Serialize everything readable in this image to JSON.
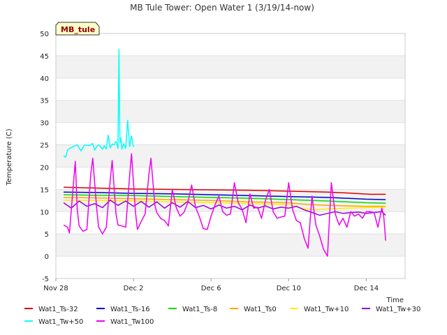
{
  "chart_data": {
    "type": "line",
    "title": "MB Tule Tower: Open Water 1 (3/19/14-now)",
    "site_badge": "MB_tule",
    "xlabel": "Time",
    "ylabel": "Temperature (C)",
    "ylim": [
      -5,
      50
    ],
    "xlim": [
      0,
      18
    ],
    "yticks": [
      -5,
      0,
      5,
      10,
      15,
      20,
      25,
      30,
      35,
      40,
      45,
      50
    ],
    "xticks": [
      {
        "value": 0,
        "label": "Nov 28"
      },
      {
        "value": 4,
        "label": "Dec 2"
      },
      {
        "value": 8,
        "label": "Dec 6"
      },
      {
        "value": 12,
        "label": "Dec 10"
      },
      {
        "value": 16,
        "label": "Dec 14"
      }
    ],
    "grid": true,
    "legend_position": "bottom",
    "series": [
      {
        "name": "Wat1_Ts-32",
        "color": "#dd0000",
        "x": [
          0.4,
          2,
          4,
          6,
          8,
          10,
          12,
          14,
          15,
          15.8,
          16.2,
          17
        ],
        "y": [
          15.5,
          15.3,
          15.1,
          15.0,
          14.9,
          14.8,
          14.6,
          14.4,
          14.2,
          14.0,
          13.9,
          13.9
        ]
      },
      {
        "name": "Wat1_Ts-16",
        "color": "#0000cc",
        "x": [
          0.4,
          2,
          4,
          6,
          8,
          10,
          12,
          14,
          15,
          16,
          17
        ],
        "y": [
          14.4,
          14.3,
          14.1,
          14.0,
          13.8,
          13.6,
          13.4,
          13.2,
          13.0,
          12.8,
          12.7
        ]
      },
      {
        "name": "Wat1_Ts-8",
        "color": "#00dd00",
        "x": [
          0.4,
          2,
          4,
          6,
          8,
          10,
          12,
          14,
          15,
          16,
          17
        ],
        "y": [
          13.8,
          13.7,
          13.6,
          13.4,
          13.2,
          13.0,
          12.7,
          12.4,
          12.2,
          12.0,
          11.9
        ]
      },
      {
        "name": "Wat1_Ts0",
        "color": "#ffa500",
        "x": [
          0.4,
          2,
          4,
          6,
          8,
          10,
          12,
          13,
          14,
          15,
          16,
          17
        ],
        "y": [
          13.2,
          13.1,
          12.9,
          12.7,
          12.5,
          12.2,
          12.0,
          11.6,
          11.4,
          11.3,
          11.2,
          11.2
        ]
      },
      {
        "name": "Wat1_Tw+10",
        "color": "#ffee00",
        "x": [
          0.4,
          2,
          4,
          6,
          8,
          10,
          12,
          12.8,
          13.4,
          14,
          15,
          16,
          17
        ],
        "y": [
          12.6,
          12.5,
          12.4,
          12.2,
          12.0,
          11.8,
          11.6,
          10.6,
          10.4,
          10.6,
          10.8,
          10.9,
          11.0
        ]
      },
      {
        "name": "Wat1_Tw+30",
        "color": "#9900dd",
        "x": [
          0.4,
          0.8,
          1.2,
          1.6,
          2.0,
          2.4,
          2.8,
          3.2,
          3.6,
          4.0,
          4.4,
          4.8,
          5.2,
          5.6,
          6.0,
          6.4,
          6.8,
          7.2,
          7.6,
          8.0,
          8.4,
          8.8,
          9.2,
          9.6,
          10.0,
          10.4,
          10.8,
          11.2,
          11.6,
          12.0,
          12.4,
          12.8,
          13.2,
          13.6,
          14.0,
          14.4,
          14.8,
          15.2,
          15.6,
          16.0,
          16.4,
          16.8,
          17.0
        ],
        "y": [
          12.0,
          10.8,
          12.4,
          11.2,
          11.8,
          10.9,
          12.6,
          11.4,
          12.4,
          11.2,
          12.3,
          11.0,
          12.2,
          10.8,
          12.0,
          11.0,
          12.3,
          10.9,
          11.4,
          10.6,
          11.5,
          10.8,
          11.2,
          10.4,
          11.5,
          10.8,
          11.3,
          10.6,
          11.0,
          10.8,
          11.2,
          10.4,
          9.8,
          9.2,
          9.6,
          10.0,
          9.6,
          9.8,
          9.9,
          9.6,
          9.8,
          10.0,
          9.2
        ]
      },
      {
        "name": "Wat1_Tw+50",
        "color": "#00ffff",
        "x": [
          0.4,
          0.5,
          0.6,
          0.7,
          0.9,
          1.1,
          1.3,
          1.4,
          1.5,
          1.7,
          1.9,
          2.0,
          2.1,
          2.2,
          2.3,
          2.4,
          2.5,
          2.6,
          2.7,
          2.8,
          2.9,
          3.0,
          3.1,
          3.2,
          3.25,
          3.3,
          3.35,
          3.4,
          3.5,
          3.6,
          3.7,
          3.8,
          3.9,
          4.0
        ],
        "y": [
          22.6,
          22.2,
          23.8,
          24.2,
          24.6,
          25.0,
          23.6,
          24.5,
          25.0,
          24.8,
          25.3,
          23.8,
          24.6,
          25.0,
          24.6,
          24.0,
          24.8,
          24.1,
          27.2,
          24.3,
          25.2,
          25.0,
          25.8,
          24.2,
          46.4,
          25.5,
          26.5,
          24.0,
          25.3,
          24.2,
          30.5,
          24.6,
          27.0,
          24.5
        ]
      },
      {
        "name": "Wat1_Tw100",
        "color": "#ee00ee",
        "x": [
          0.4,
          0.6,
          0.7,
          0.9,
          1.0,
          1.1,
          1.2,
          1.4,
          1.6,
          1.8,
          1.9,
          2.1,
          2.2,
          2.4,
          2.6,
          2.8,
          2.9,
          3.1,
          3.2,
          3.4,
          3.6,
          3.8,
          3.9,
          4.1,
          4.2,
          4.4,
          4.6,
          4.8,
          4.9,
          5.1,
          5.2,
          5.4,
          5.6,
          5.8,
          6.0,
          6.2,
          6.4,
          6.6,
          6.8,
          7.0,
          7.2,
          7.4,
          7.6,
          7.8,
          8.0,
          8.2,
          8.4,
          8.6,
          8.8,
          9.0,
          9.2,
          9.4,
          9.6,
          9.8,
          10.0,
          10.2,
          10.4,
          10.6,
          10.8,
          11.0,
          11.2,
          11.4,
          11.6,
          11.8,
          12.0,
          12.2,
          12.4,
          12.6,
          12.8,
          13.0,
          13.2,
          13.4,
          13.6,
          13.8,
          14.0,
          14.2,
          14.4,
          14.6,
          14.8,
          15.0,
          15.2,
          15.4,
          15.6,
          15.8,
          16.0,
          16.2,
          16.4,
          16.6,
          16.8,
          16.9,
          17.0
        ],
        "y": [
          7.0,
          6.5,
          5.2,
          16.0,
          21.3,
          10.5,
          6.8,
          5.6,
          6.0,
          18.5,
          22.0,
          11.0,
          6.6,
          5.0,
          6.5,
          17.0,
          21.5,
          9.5,
          7.0,
          6.8,
          6.5,
          18.0,
          23.0,
          10.0,
          6.0,
          7.8,
          9.5,
          18.5,
          22.0,
          11.5,
          9.8,
          8.5,
          8.0,
          6.8,
          15.0,
          11.0,
          9.0,
          9.8,
          12.0,
          16.0,
          11.0,
          8.8,
          6.2,
          6.0,
          9.0,
          11.5,
          13.5,
          10.0,
          9.2,
          9.5,
          16.5,
          12.0,
          10.5,
          7.5,
          14.0,
          10.8,
          11.0,
          8.5,
          12.5,
          15.0,
          10.0,
          8.5,
          8.8,
          9.0,
          16.5,
          10.5,
          8.0,
          7.5,
          4.0,
          1.8,
          13.5,
          7.0,
          4.5,
          1.5,
          0.0,
          16.5,
          9.5,
          7.0,
          8.5,
          6.5,
          10.0,
          9.0,
          9.5,
          8.5,
          10.0,
          10.0,
          9.8,
          6.5,
          10.8,
          9.0,
          3.5
        ]
      }
    ]
  }
}
